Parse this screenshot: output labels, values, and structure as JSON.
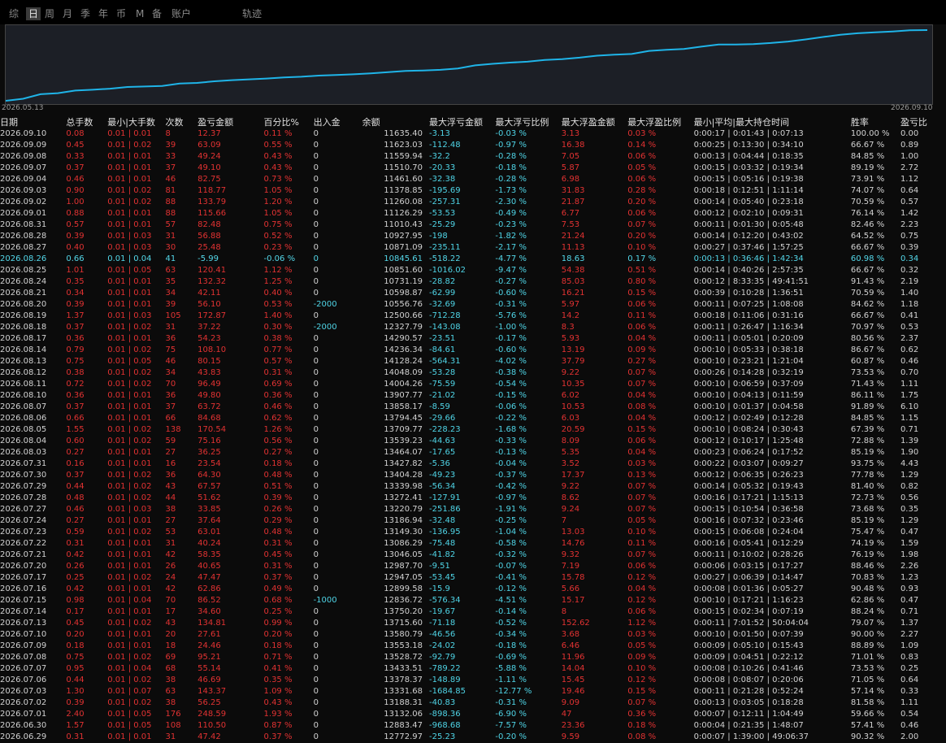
{
  "tabs": [
    "综",
    "日",
    "周",
    "月",
    "季",
    "年",
    "币",
    "M",
    "备",
    "账户",
    "轨迹"
  ],
  "active_tab": "日",
  "chart_data": {
    "type": "line",
    "x_start": "2026.05.13",
    "x_end": "2026.09.10",
    "color": "#1fb4e8"
  },
  "columns": [
    "日期",
    "总手数",
    "最小|大手数",
    "次数",
    "盈亏金额",
    "百分比%",
    "出入金",
    "余额",
    "最大浮亏金额",
    "最大浮亏比例",
    "最大浮盈金额",
    "最大浮盈比例",
    "最小|平均|最大持仓时间",
    "胜率",
    "盈亏比"
  ],
  "rows": [
    [
      "2026.09.10",
      "0.08",
      "0.01 | 0.01",
      "8",
      "12.37",
      "0.11 %",
      "0",
      "11635.40",
      "-3.13",
      "-0.03 %",
      "3.13",
      "0.03 %",
      "0:00:17 | 0:01:43 | 0:07:13",
      "100.00 %",
      "0.00"
    ],
    [
      "2026.09.09",
      "0.45",
      "0.01 | 0.02",
      "39",
      "63.09",
      "0.55 %",
      "0",
      "11623.03",
      "-112.48",
      "-0.97 %",
      "16.38",
      "0.14 %",
      "0:00:25 | 0:13:30 | 0:34:10",
      "66.67 %",
      "0.89"
    ],
    [
      "2026.09.08",
      "0.33",
      "0.01 | 0.01",
      "33",
      "49.24",
      "0.43 %",
      "0",
      "11559.94",
      "-32.2",
      "-0.28 %",
      "7.05",
      "0.06 %",
      "0:00:13 | 0:04:44 | 0:18:35",
      "84.85 %",
      "1.00"
    ],
    [
      "2026.09.07",
      "0.37",
      "0.01 | 0.01",
      "37",
      "49.10",
      "0.43 %",
      "0",
      "11510.70",
      "-20.33",
      "-0.18 %",
      "5.87",
      "0.05 %",
      "0:00:15 | 0:03:32 | 0:19:34",
      "89.19 %",
      "2.72"
    ],
    [
      "2026.09.04",
      "0.46",
      "0.01 | 0.01",
      "46",
      "82.75",
      "0.73 %",
      "0",
      "11461.60",
      "-32.38",
      "-0.28 %",
      "6.98",
      "0.06 %",
      "0:00:15 | 0:05:16 | 0:19:38",
      "73.91 %",
      "1.12"
    ],
    [
      "2026.09.03",
      "0.90",
      "0.01 | 0.02",
      "81",
      "118.77",
      "1.05 %",
      "0",
      "11378.85",
      "-195.69",
      "-1.73 %",
      "31.83",
      "0.28 %",
      "0:00:18 | 0:12:51 | 1:11:14",
      "74.07 %",
      "0.64"
    ],
    [
      "2026.09.02",
      "1.00",
      "0.01 | 0.02",
      "88",
      "133.79",
      "1.20 %",
      "0",
      "11260.08",
      "-257.31",
      "-2.30 %",
      "21.87",
      "0.20 %",
      "0:00:14 | 0:05:40 | 0:23:18",
      "70.59 %",
      "0.57"
    ],
    [
      "2026.09.01",
      "0.88",
      "0.01 | 0.01",
      "88",
      "115.66",
      "1.05 %",
      "0",
      "11126.29",
      "-53.53",
      "-0.49 %",
      "6.77",
      "0.06 %",
      "0:00:12 | 0:02:10 | 0:09:31",
      "76.14 %",
      "1.42"
    ],
    [
      "2026.08.31",
      "0.57",
      "0.01 | 0.01",
      "57",
      "82.48",
      "0.75 %",
      "0",
      "11010.43",
      "-25.29",
      "-0.23 %",
      "7.53",
      "0.07 %",
      "0:00:11 | 0:01:30 | 0:05:48",
      "82.46 %",
      "2.23"
    ],
    [
      "2026.08.28",
      "0.39",
      "0.01 | 0.03",
      "31",
      "56.88",
      "0.52 %",
      "0",
      "10927.95",
      "-198",
      "-1.82 %",
      "21.24",
      "0.20 %",
      "0:00:14 | 0:12:20 | 0:43:02",
      "64.52 %",
      "0.75"
    ],
    [
      "2026.08.27",
      "0.40",
      "0.01 | 0.03",
      "30",
      "25.48",
      "0.23 %",
      "0",
      "10871.09",
      "-235.11",
      "-2.17 %",
      "11.13",
      "0.10 %",
      "0:00:27 | 0:37:46 | 1:57:25",
      "66.67 %",
      "0.39"
    ],
    [
      "2026.08.26",
      "0.66",
      "0.01 | 0.04",
      "41",
      "-5.99",
      "-0.06 %",
      "0",
      "10845.61",
      "-518.22",
      "-4.77 %",
      "18.63",
      "0.17 %",
      "0:00:13 | 0:36:46 | 1:42:34",
      "60.98 %",
      "0.34"
    ],
    [
      "2026.08.25",
      "1.01",
      "0.01 | 0.05",
      "63",
      "120.41",
      "1.12 %",
      "0",
      "10851.60",
      "-1016.02",
      "-9.47 %",
      "54.38",
      "0.51 %",
      "0:00:14 | 0:40:26 | 2:57:35",
      "66.67 %",
      "0.32"
    ],
    [
      "2026.08.24",
      "0.35",
      "0.01 | 0.01",
      "35",
      "132.32",
      "1.25 %",
      "0",
      "10731.19",
      "-28.82",
      "-0.27 %",
      "85.03",
      "0.80 %",
      "0:00:12 | 8:33:35 | 49:41:51",
      "91.43 %",
      "2.19"
    ],
    [
      "2026.08.21",
      "0.34",
      "0.01 | 0.01",
      "34",
      "42.11",
      "0.40 %",
      "0",
      "10598.87",
      "-62.99",
      "-0.60 %",
      "16.21",
      "0.15 %",
      "0:00:39 | 0:10:28 | 1:36:51",
      "70.59 %",
      "1.40"
    ],
    [
      "2026.08.20",
      "0.39",
      "0.01 | 0.01",
      "39",
      "56.10",
      "0.53 %",
      "-2000",
      "10556.76",
      "-32.69",
      "-0.31 %",
      "5.97",
      "0.06 %",
      "0:00:11 | 0:07:25 | 1:08:08",
      "84.62 %",
      "1.18"
    ],
    [
      "2026.08.19",
      "1.37",
      "0.01 | 0.03",
      "105",
      "172.87",
      "1.40 %",
      "0",
      "12500.66",
      "-712.28",
      "-5.76 %",
      "14.2",
      "0.11 %",
      "0:00:18 | 0:11:06 | 0:31:16",
      "66.67 %",
      "0.41"
    ],
    [
      "2026.08.18",
      "0.37",
      "0.01 | 0.02",
      "31",
      "37.22",
      "0.30 %",
      "-2000",
      "12327.79",
      "-143.08",
      "-1.00 %",
      "8.3",
      "0.06 %",
      "0:00:11 | 0:26:47 | 1:16:34",
      "70.97 %",
      "0.53"
    ],
    [
      "2026.08.17",
      "0.36",
      "0.01 | 0.01",
      "36",
      "54.23",
      "0.38 %",
      "0",
      "14290.57",
      "-23.51",
      "-0.17 %",
      "5.93",
      "0.04 %",
      "0:00:11 | 0:05:01 | 0:20:09",
      "80.56 %",
      "2.37"
    ],
    [
      "2026.08.14",
      "0.79",
      "0.01 | 0.02",
      "75",
      "108.10",
      "0.77 %",
      "0",
      "14236.34",
      "-84.61",
      "-0.60 %",
      "13.19",
      "0.09 %",
      "0:00:10 | 0:05:33 | 0:38:18",
      "86.67 %",
      "0.62"
    ],
    [
      "2026.08.13",
      "0.75",
      "0.01 | 0.05",
      "46",
      "80.15",
      "0.57 %",
      "0",
      "14128.24",
      "-564.31",
      "-4.02 %",
      "37.79",
      "0.27 %",
      "0:00:10 | 0:23:21 | 1:21:04",
      "60.87 %",
      "0.46"
    ],
    [
      "2026.08.12",
      "0.38",
      "0.01 | 0.02",
      "34",
      "43.83",
      "0.31 %",
      "0",
      "14048.09",
      "-53.28",
      "-0.38 %",
      "9.22",
      "0.07 %",
      "0:00:26 | 0:14:28 | 0:32:19",
      "73.53 %",
      "0.70"
    ],
    [
      "2026.08.11",
      "0.72",
      "0.01 | 0.02",
      "70",
      "96.49",
      "0.69 %",
      "0",
      "14004.26",
      "-75.59",
      "-0.54 %",
      "10.35",
      "0.07 %",
      "0:00:10 | 0:06:59 | 0:37:09",
      "71.43 %",
      "1.11"
    ],
    [
      "2026.08.10",
      "0.36",
      "0.01 | 0.01",
      "36",
      "49.80",
      "0.36 %",
      "0",
      "13907.77",
      "-21.02",
      "-0.15 %",
      "6.02",
      "0.04 %",
      "0:00:10 | 0:04:13 | 0:11:59",
      "86.11 %",
      "1.75"
    ],
    [
      "2026.08.07",
      "0.37",
      "0.01 | 0.01",
      "37",
      "63.72",
      "0.46 %",
      "0",
      "13858.17",
      "-8.59",
      "-0.06 %",
      "10.53",
      "0.08 %",
      "0:00:10 | 0:01:37 | 0:04:58",
      "91.89 %",
      "6.10"
    ],
    [
      "2026.08.06",
      "0.66",
      "0.01 | 0.01",
      "66",
      "84.68",
      "0.62 %",
      "0",
      "13794.45",
      "-29.66",
      "-0.22 %",
      "6.03",
      "0.04 %",
      "0:00:12 | 0:02:49 | 0:12:28",
      "84.85 %",
      "1.15"
    ],
    [
      "2026.08.05",
      "1.55",
      "0.01 | 0.02",
      "138",
      "170.54",
      "1.26 %",
      "0",
      "13709.77",
      "-228.23",
      "-1.68 %",
      "20.59",
      "0.15 %",
      "0:00:10 | 0:08:24 | 0:30:43",
      "67.39 %",
      "0.71"
    ],
    [
      "2026.08.04",
      "0.60",
      "0.01 | 0.02",
      "59",
      "75.16",
      "0.56 %",
      "0",
      "13539.23",
      "-44.63",
      "-0.33 %",
      "8.09",
      "0.06 %",
      "0:00:12 | 0:10:17 | 1:25:48",
      "72.88 %",
      "1.39"
    ],
    [
      "2026.08.03",
      "0.27",
      "0.01 | 0.01",
      "27",
      "36.25",
      "0.27 %",
      "0",
      "13464.07",
      "-17.65",
      "-0.13 %",
      "5.35",
      "0.04 %",
      "0:00:23 | 0:06:24 | 0:17:52",
      "85.19 %",
      "1.90"
    ],
    [
      "2026.07.31",
      "0.16",
      "0.01 | 0.01",
      "16",
      "23.54",
      "0.18 %",
      "0",
      "13427.82",
      "-5.36",
      "-0.04 %",
      "3.52",
      "0.03 %",
      "0:00:22 | 0:03:07 | 0:09:27",
      "93.75 %",
      "4.43"
    ],
    [
      "2026.07.30",
      "0.37",
      "0.01 | 0.02",
      "36",
      "64.30",
      "0.48 %",
      "0",
      "13404.28",
      "-49.23",
      "-0.37 %",
      "17.37",
      "0.13 %",
      "0:00:12 | 0:06:35 | 0:26:23",
      "77.78 %",
      "1.29"
    ],
    [
      "2026.07.29",
      "0.44",
      "0.01 | 0.02",
      "43",
      "67.57",
      "0.51 %",
      "0",
      "13339.98",
      "-56.34",
      "-0.42 %",
      "9.22",
      "0.07 %",
      "0:00:14 | 0:05:32 | 0:19:43",
      "81.40 %",
      "0.82"
    ],
    [
      "2026.07.28",
      "0.48",
      "0.01 | 0.02",
      "44",
      "51.62",
      "0.39 %",
      "0",
      "13272.41",
      "-127.91",
      "-0.97 %",
      "8.62",
      "0.07 %",
      "0:00:16 | 0:17:21 | 1:15:13",
      "72.73 %",
      "0.56"
    ],
    [
      "2026.07.27",
      "0.46",
      "0.01 | 0.03",
      "38",
      "33.85",
      "0.26 %",
      "0",
      "13220.79",
      "-251.86",
      "-1.91 %",
      "9.24",
      "0.07 %",
      "0:00:15 | 0:10:54 | 0:36:58",
      "73.68 %",
      "0.35"
    ],
    [
      "2026.07.24",
      "0.27",
      "0.01 | 0.01",
      "27",
      "37.64",
      "0.29 %",
      "0",
      "13186.94",
      "-32.48",
      "-0.25 %",
      "7",
      "0.05 %",
      "0:00:16 | 0:07:32 | 0:23:46",
      "85.19 %",
      "1.29"
    ],
    [
      "2026.07.23",
      "0.59",
      "0.01 | 0.02",
      "53",
      "63.01",
      "0.48 %",
      "0",
      "13149.30",
      "-136.95",
      "-1.04 %",
      "13.03",
      "0.10 %",
      "0:00:15 | 0:06:08 | 0:24:04",
      "75.47 %",
      "0.47"
    ],
    [
      "2026.07.22",
      "0.31",
      "0.01 | 0.01",
      "31",
      "40.24",
      "0.31 %",
      "0",
      "13086.29",
      "-75.48",
      "-0.58 %",
      "14.76",
      "0.11 %",
      "0:00:16 | 0:05:41 | 0:12:29",
      "74.19 %",
      "1.59"
    ],
    [
      "2026.07.21",
      "0.42",
      "0.01 | 0.01",
      "42",
      "58.35",
      "0.45 %",
      "0",
      "13046.05",
      "-41.82",
      "-0.32 %",
      "9.32",
      "0.07 %",
      "0:00:11 | 0:10:02 | 0:28:26",
      "76.19 %",
      "1.98"
    ],
    [
      "2026.07.20",
      "0.26",
      "0.01 | 0.01",
      "26",
      "40.65",
      "0.31 %",
      "0",
      "12987.70",
      "-9.51",
      "-0.07 %",
      "7.19",
      "0.06 %",
      "0:00:06 | 0:03:15 | 0:17:27",
      "88.46 %",
      "2.26"
    ],
    [
      "2026.07.17",
      "0.25",
      "0.01 | 0.02",
      "24",
      "47.47",
      "0.37 %",
      "0",
      "12947.05",
      "-53.45",
      "-0.41 %",
      "15.78",
      "0.12 %",
      "0:00:27 | 0:06:39 | 0:14:47",
      "70.83 %",
      "1.23"
    ],
    [
      "2026.07.16",
      "0.42",
      "0.01 | 0.01",
      "42",
      "62.86",
      "0.49 %",
      "0",
      "12899.58",
      "-15.9",
      "-0.12 %",
      "5.66",
      "0.04 %",
      "0:00:08 | 0:01:36 | 0:05:27",
      "90.48 %",
      "0.93"
    ],
    [
      "2026.07.15",
      "0.98",
      "0.01 | 0.04",
      "70",
      "86.52",
      "0.68 %",
      "-1000",
      "12836.72",
      "-576.34",
      "-4.51 %",
      "15.17",
      "0.12 %",
      "0:00:10 | 0:17:21 | 1:16:23",
      "62.86 %",
      "0.47"
    ],
    [
      "2026.07.14",
      "0.17",
      "0.01 | 0.01",
      "17",
      "34.60",
      "0.25 %",
      "0",
      "13750.20",
      "-19.67",
      "-0.14 %",
      "8",
      "0.06 %",
      "0:00:15 | 0:02:34 | 0:07:19",
      "88.24 %",
      "0.71"
    ],
    [
      "2026.07.13",
      "0.45",
      "0.01 | 0.02",
      "43",
      "134.81",
      "0.99 %",
      "0",
      "13715.60",
      "-71.18",
      "-0.52 %",
      "152.62",
      "1.12 %",
      "0:00:11 | 7:01:52 | 50:04:04",
      "79.07 %",
      "1.37"
    ],
    [
      "2026.07.10",
      "0.20",
      "0.01 | 0.01",
      "20",
      "27.61",
      "0.20 %",
      "0",
      "13580.79",
      "-46.56",
      "-0.34 %",
      "3.68",
      "0.03 %",
      "0:00:10 | 0:01:50 | 0:07:39",
      "90.00 %",
      "2.27"
    ],
    [
      "2026.07.09",
      "0.18",
      "0.01 | 0.01",
      "18",
      "24.46",
      "0.18 %",
      "0",
      "13553.18",
      "-24.02",
      "-0.18 %",
      "6.46",
      "0.05 %",
      "0:00:09 | 0:05:10 | 0:15:43",
      "88.89 %",
      "1.09"
    ],
    [
      "2026.07.08",
      "0.75",
      "0.01 | 0.02",
      "69",
      "95.21",
      "0.71 %",
      "0",
      "13528.72",
      "-92.79",
      "-0.69 %",
      "11.96",
      "0.09 %",
      "0:00:09 | 0:04:51 | 0:22:12",
      "71.01 %",
      "0.83"
    ],
    [
      "2026.07.07",
      "0.95",
      "0.01 | 0.04",
      "68",
      "55.14",
      "0.41 %",
      "0",
      "13433.51",
      "-789.22",
      "-5.88 %",
      "14.04",
      "0.10 %",
      "0:00:08 | 0:10:26 | 0:41:46",
      "73.53 %",
      "0.25"
    ],
    [
      "2026.07.06",
      "0.44",
      "0.01 | 0.02",
      "38",
      "46.69",
      "0.35 %",
      "0",
      "13378.37",
      "-148.89",
      "-1.11 %",
      "15.45",
      "0.12 %",
      "0:00:08 | 0:08:07 | 0:20:06",
      "71.05 %",
      "0.64"
    ],
    [
      "2026.07.03",
      "1.30",
      "0.01 | 0.07",
      "63",
      "143.37",
      "1.09 %",
      "0",
      "13331.68",
      "-1684.85",
      "-12.77 %",
      "19.46",
      "0.15 %",
      "0:00:11 | 0:21:28 | 0:52:24",
      "57.14 %",
      "0.33"
    ],
    [
      "2026.07.02",
      "0.39",
      "0.01 | 0.02",
      "38",
      "56.25",
      "0.43 %",
      "0",
      "13188.31",
      "-40.83",
      "-0.31 %",
      "9.09",
      "0.07 %",
      "0:00:13 | 0:03:05 | 0:18:28",
      "81.58 %",
      "1.11"
    ],
    [
      "2026.07.01",
      "2.40",
      "0.01 | 0.05",
      "176",
      "248.59",
      "1.93 %",
      "0",
      "13132.06",
      "-898.36",
      "-6.90 %",
      "47",
      "0.36 %",
      "0:00:07 | 0:12:11 | 1:04:49",
      "59.66 %",
      "0.54"
    ],
    [
      "2026.06.30",
      "1.57",
      "0.01 | 0.05",
      "108",
      "110.50",
      "0.87 %",
      "0",
      "12883.47",
      "-968.68",
      "-7.57 %",
      "23.36",
      "0.18 %",
      "0:00:04 | 0:21:35 | 1:48:07",
      "57.41 %",
      "0.46"
    ],
    [
      "2026.06.29",
      "0.31",
      "0.01 | 0.01",
      "31",
      "47.42",
      "0.37 %",
      "0",
      "12772.97",
      "-25.23",
      "-0.20 %",
      "9.59",
      "0.08 %",
      "0:00:07 | 1:39:00 | 49:06:37",
      "90.32 %",
      "2.00"
    ]
  ]
}
